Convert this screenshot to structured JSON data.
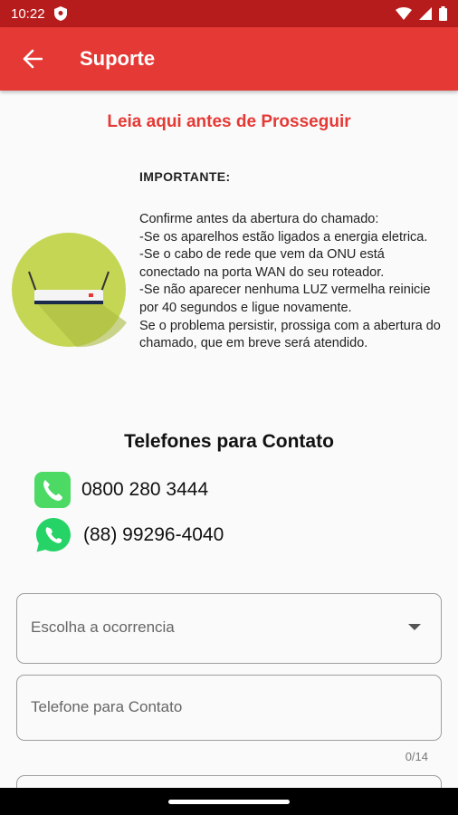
{
  "status_bar": {
    "time": "10:22"
  },
  "app_bar": {
    "title": "Suporte"
  },
  "notice": {
    "heading": "Leia aqui antes de Prosseguir"
  },
  "info": {
    "important_label": "IMPORTANTE:",
    "body": "Confirme antes da abertura do chamado:\n-Se os aparelhos estão ligados a energia eletrica.\n-Se o cabo de rede que vem da ONU está conectado na porta WAN do seu roteador.\n-Se não aparecer nenhuma LUZ vermelha reinicie por 40 segundos e ligue novamente.\nSe o problema persistir, prossiga com a abertura do chamado, que em breve será atendido."
  },
  "contacts": {
    "title": "Telefones para Contato",
    "phone": "0800 280 3444",
    "whatsapp": "(88) 99296-4040"
  },
  "form": {
    "occurrence_label": "Escolha a ocorrencia",
    "phone_label": "Telefone para Contato",
    "phone_counter": "0/14"
  },
  "colors": {
    "primary": "#e53935",
    "status_bar": "#b71c1c",
    "router_circle": "#c5d655",
    "whatsapp": "#25d366"
  }
}
